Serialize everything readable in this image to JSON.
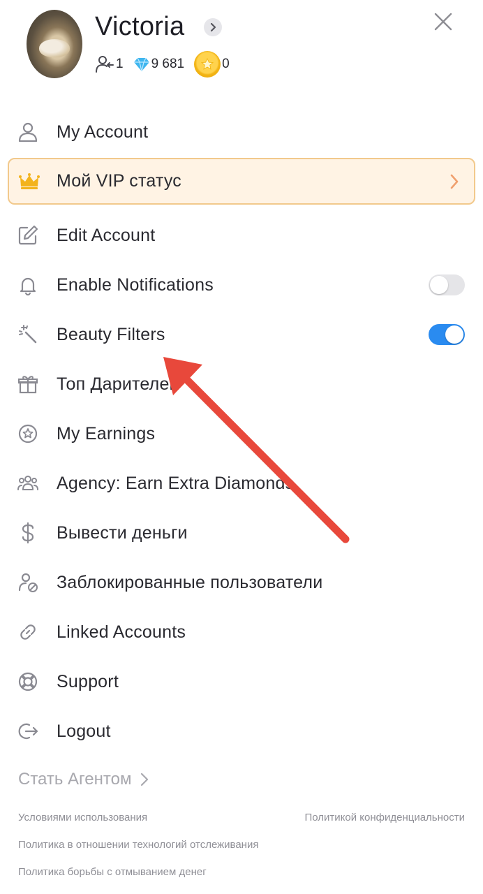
{
  "profile": {
    "name": "Victoria",
    "followers": "1",
    "diamonds": "9 681",
    "coins": "0"
  },
  "menu": {
    "items": [
      {
        "label": "My Account",
        "icon": "user-icon"
      },
      {
        "label": "Мой VIP статус",
        "icon": "crown-icon"
      },
      {
        "label": "Edit Account",
        "icon": "edit-icon"
      },
      {
        "label": "Enable Notifications",
        "icon": "bell-icon",
        "toggle": "off"
      },
      {
        "label": "Beauty Filters",
        "icon": "magic-wand-icon",
        "toggle": "on"
      },
      {
        "label": "Топ Дарителей",
        "icon": "gift-icon"
      },
      {
        "label": "My Earnings",
        "icon": "star-badge-icon"
      },
      {
        "label": "Agency: Earn Extra Diamonds",
        "icon": "group-icon"
      },
      {
        "label": "Вывести деньги",
        "icon": "dollar-icon"
      },
      {
        "label": "Заблокированные пользователи",
        "icon": "blocked-user-icon"
      },
      {
        "label": "Linked Accounts",
        "icon": "link-icon"
      },
      {
        "label": "Support",
        "icon": "lifebuoy-icon"
      },
      {
        "label": "Logout",
        "icon": "logout-icon"
      }
    ]
  },
  "footer": {
    "agent_link": "Стать Агентом",
    "terms": "Условиями использования",
    "privacy": "Политикой конфиденциальности",
    "tracking": "Политика в отношении технологий отслеживания",
    "aml": "Политика борьбы с отмыванием денег"
  },
  "colors": {
    "accent_blue": "#2a8bf0",
    "vip_background": "#fff3e4",
    "vip_border": "#f2c98c",
    "annotation_arrow": "#e8483b"
  }
}
